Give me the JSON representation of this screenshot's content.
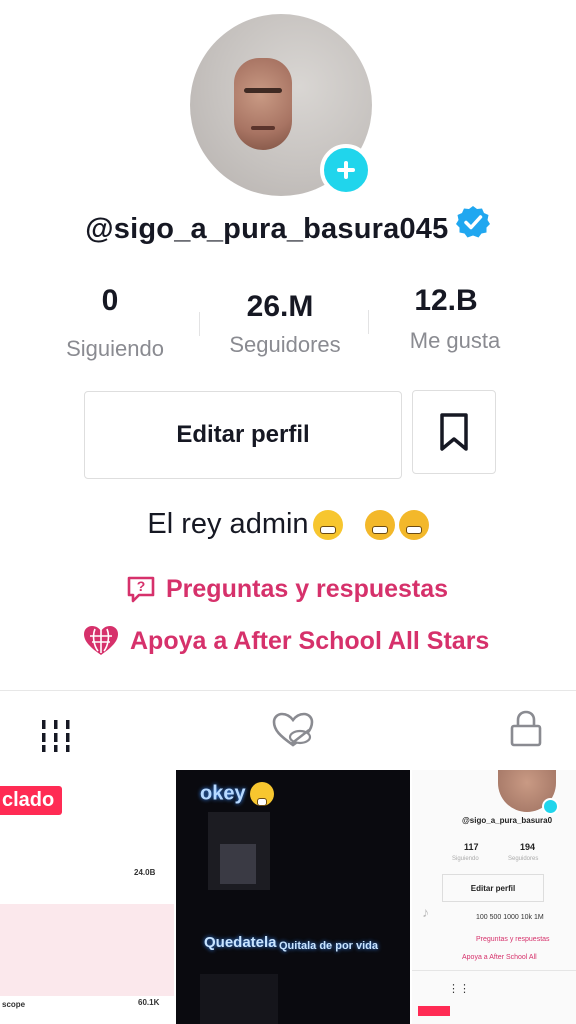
{
  "profile": {
    "username": "@sigo_a_pura_basura045",
    "bio": "El rey admin",
    "verified": true
  },
  "stats": [
    {
      "value": "0",
      "label": "Siguiendo"
    },
    {
      "value": "26.M",
      "label": "Seguidores"
    },
    {
      "value": "12.B",
      "label": "Me gusta"
    }
  ],
  "actions": {
    "edit_label": "Editar perfil"
  },
  "links": {
    "qa_label": "Preguntas y respuestas",
    "charity_label": "Apoya a After School All Stars"
  },
  "colors": {
    "accent_pink": "#d6316b",
    "plus_cyan": "#20d5ec",
    "verified_blue": "#20a7f0"
  },
  "grid": {
    "thumb1": {
      "badge": "clado",
      "count_a": "24.0B",
      "caption_b": "scope",
      "count_b": "60.1K"
    },
    "thumb2": {
      "top_text": "okey",
      "caption_main": "Quedatela",
      "caption_sub": "Quitala de por vida"
    },
    "thumb3": {
      "username": "@sigo_a_pura_basura0",
      "stat_a": "117",
      "stat_b": "194",
      "stat_a_label": "Siguiendo",
      "stat_b_label": "Seguidores",
      "edit_label": "Editar perfil",
      "bio": "100 500 1000 10k 1M",
      "qa": "Preguntas y respuestas",
      "charity": "Apoya a After School All"
    }
  }
}
